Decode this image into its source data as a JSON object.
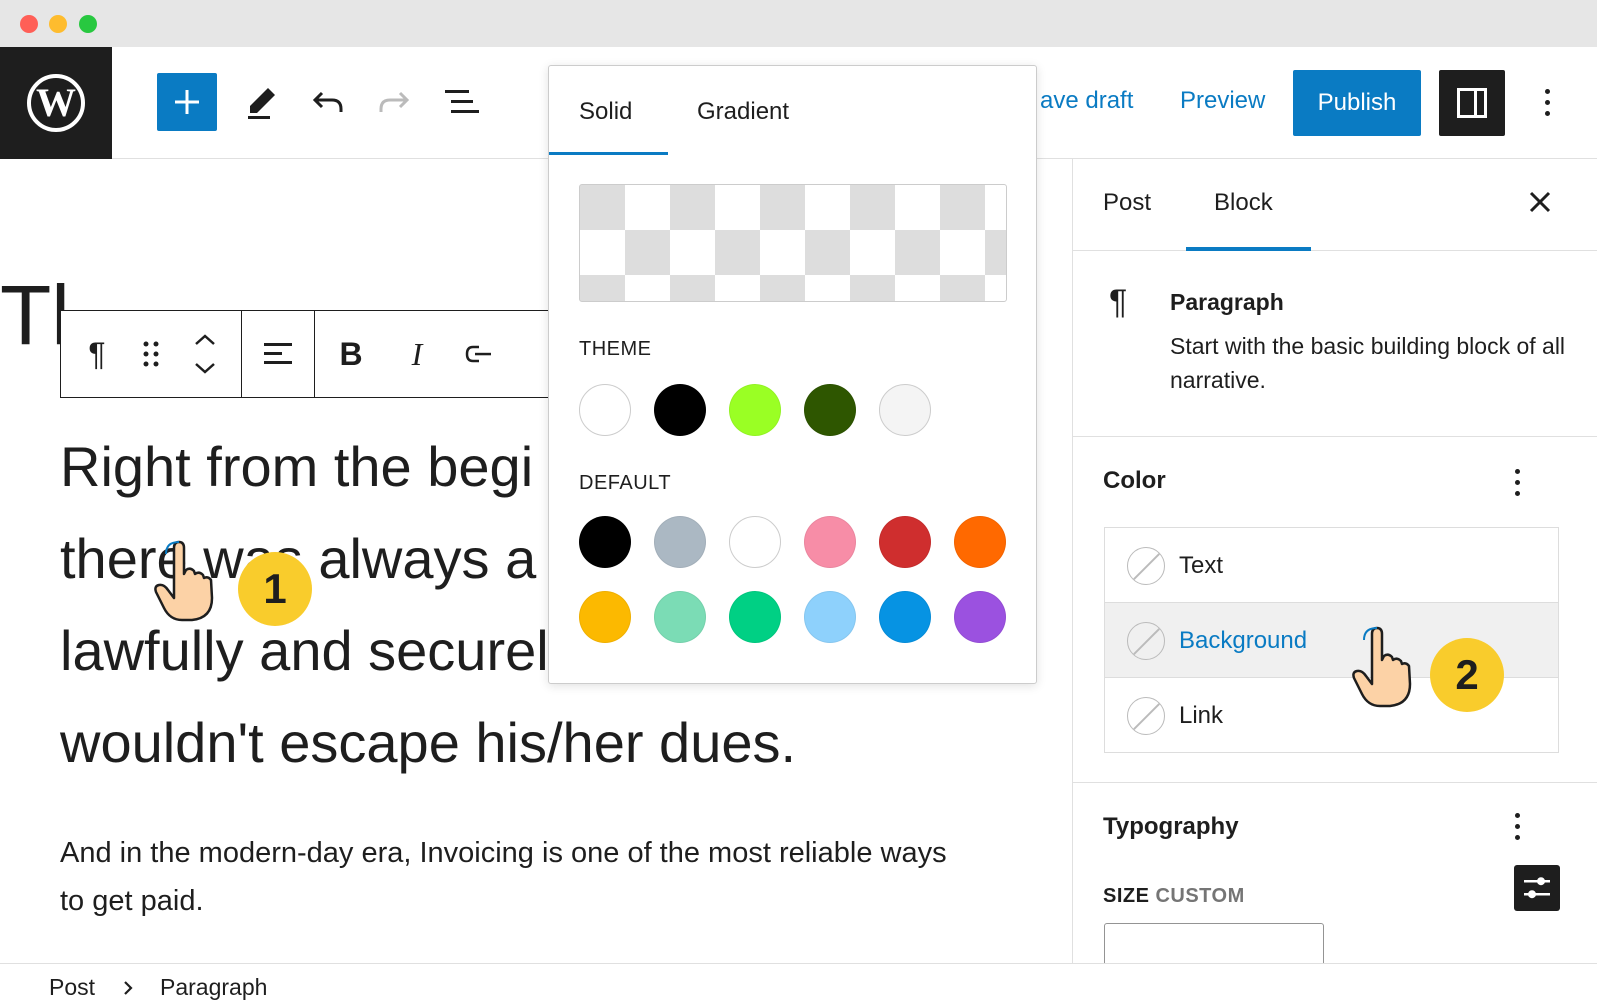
{
  "header": {
    "save_draft_label": "ave draft",
    "preview_label": "Preview",
    "publish_label": "Publish"
  },
  "editor": {
    "title_fragment": "Tl",
    "paragraph_big": "Right from the beginning, there was always a way to get paid lawfully and securely so that everybody wouldn't escape his/her dues.",
    "paragraph_big_lines": [
      "Right from the begi",
      "there was always a ",
      "lawfully and securel",
      "wouldn't escape his/her dues."
    ],
    "paragraph_small_lines": [
      "And in the modern-day era, Invoicing is one of the most reliable ways",
      "to get paid."
    ]
  },
  "popover": {
    "tabs": [
      "Solid",
      "Gradient"
    ],
    "theme_label": "THEME",
    "default_label": "DEFAULT",
    "theme_colors": [
      "#ffffff",
      "#000000",
      "#9aff24",
      "#2e5600",
      "#f4f4f4"
    ],
    "default_colors": [
      "#000000",
      "#abb8c3",
      "#ffffff",
      "#f78da7",
      "#cf2e2e",
      "#ff6900",
      "#fcb900",
      "#7bdcb5",
      "#00d084",
      "#8ed1fc",
      "#0693e3",
      "#9b51e0"
    ]
  },
  "sidebar": {
    "tabs": [
      "Post",
      "Block"
    ],
    "block_name": "Paragraph",
    "block_description": "Start with the basic building block of all narrative.",
    "color_title": "Color",
    "color_items": [
      "Text",
      "Background",
      "Link"
    ],
    "typography_title": "Typography",
    "size_label": "SIZE",
    "size_custom": "CUSTOM"
  },
  "breadcrumb": {
    "items": [
      "Post",
      "Paragraph"
    ]
  },
  "annotations": {
    "step1": "1",
    "step2": "2"
  },
  "colors": {
    "accent": "#0a7bc3",
    "badge": "#f9cc2c",
    "dark": "#1e1e1e"
  }
}
